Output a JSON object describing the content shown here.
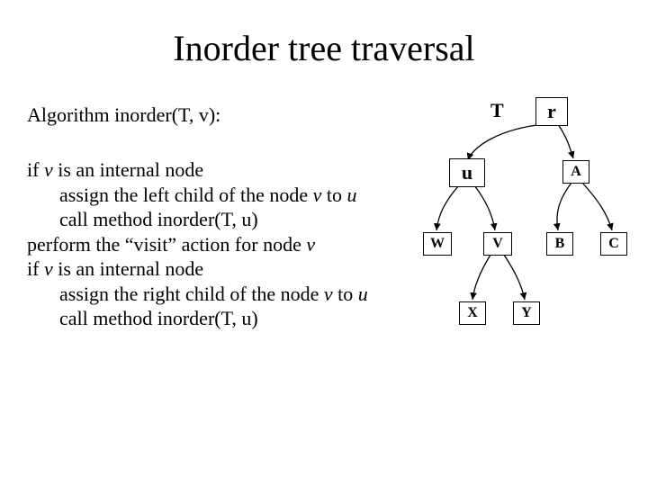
{
  "title": "Inorder tree traversal",
  "algo_heading": "Algorithm inorder(T, v):",
  "pseudo": {
    "l1a": "if ",
    "l1b": "v",
    "l1c": " is an internal node",
    "l2a": "assign the left child of the node ",
    "l2b": "v",
    "l2c": " to ",
    "l2d": "u",
    "l3": "call method inorder(T, u)",
    "l4a": "perform the “visit” action for node ",
    "l4b": "v",
    "l5a": "if ",
    "l5b": "v",
    "l5c": " is an internal node",
    "l6a": "assign the right child of the node ",
    "l6b": "v",
    "l6c": " to ",
    "l6d": "u",
    "l7": "call method inorder(T, u)"
  },
  "diagram": {
    "tree_label": "T",
    "nodes": {
      "r": "r",
      "u": "u",
      "A": "A",
      "W": "W",
      "V": "V",
      "B": "B",
      "C": "C",
      "X": "X",
      "Y": "Y"
    },
    "edges": [
      {
        "from": "r",
        "to": "u"
      },
      {
        "from": "r",
        "to": "A"
      },
      {
        "from": "u",
        "to": "W"
      },
      {
        "from": "u",
        "to": "V"
      },
      {
        "from": "A",
        "to": "B"
      },
      {
        "from": "A",
        "to": "C"
      },
      {
        "from": "V",
        "to": "X"
      },
      {
        "from": "V",
        "to": "Y"
      }
    ]
  }
}
